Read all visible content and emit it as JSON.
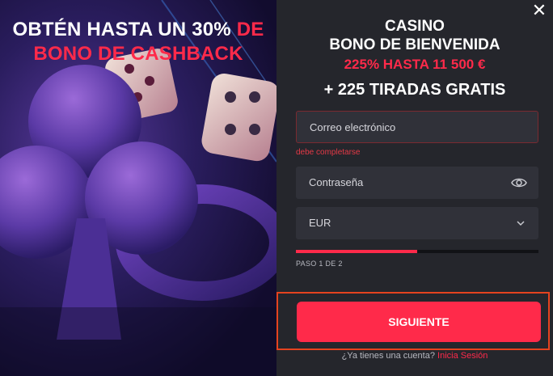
{
  "promo": {
    "headline_white": "OBTÉN HASTA UN 30%",
    "headline_accent_1": "DE",
    "headline_accent_2": "BONO DE CASHBACK"
  },
  "modal": {
    "close_label": "✕",
    "title_line1": "CASINO",
    "title_line2": "BONO DE BIENVENIDA",
    "bonus_amount": "225% HASTA 11 500 €",
    "free_spins": "+ 225 TIRADAS GRATIS"
  },
  "form": {
    "email_placeholder": "Correo electrónico",
    "email_error": "debe completarse",
    "password_placeholder": "Contraseña",
    "currency_value": "EUR",
    "progress": 0.5,
    "step_text": "PASO 1 DE 2",
    "next_button": "SIGUIENTE",
    "login_prompt": "¿Ya tienes una cuenta?",
    "login_link": "Inicia Sesión"
  },
  "colors": {
    "accent": "#ff2a4a",
    "panel_bg": "#25262c",
    "field_bg": "#303139",
    "highlight_border": "#e5431f"
  }
}
